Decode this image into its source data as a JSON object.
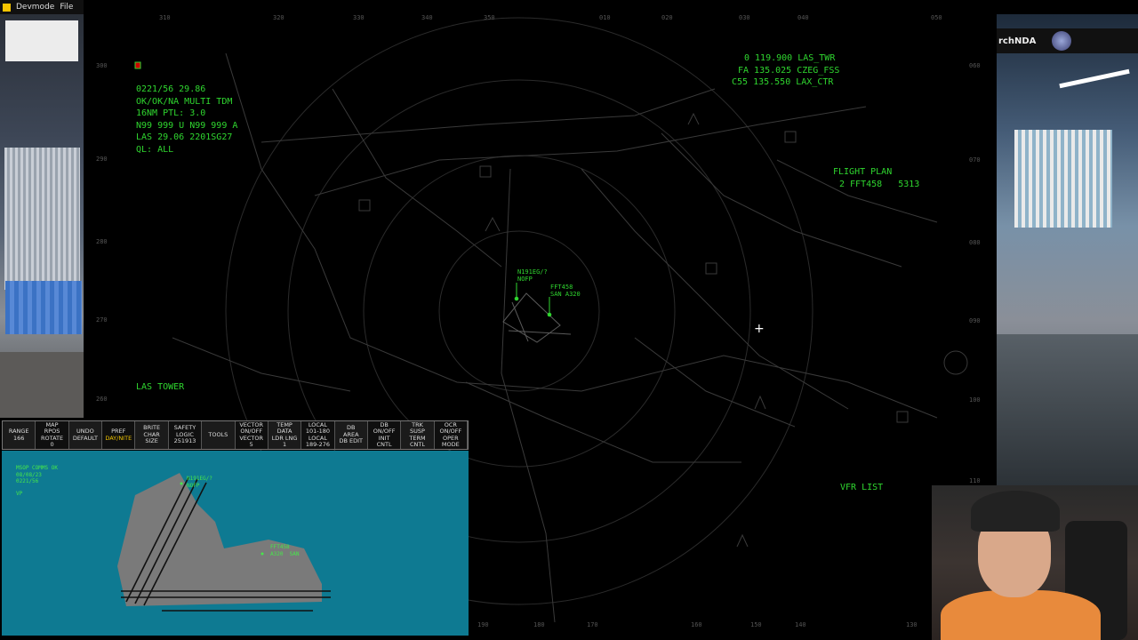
{
  "menubar": {
    "app_label": "Devmode",
    "file_label": "File"
  },
  "user": {
    "name": "rchNDA"
  },
  "radar": {
    "compass_top": [
      "310",
      "320",
      "330",
      "340",
      "350",
      "010",
      "020",
      "030",
      "040",
      "050"
    ],
    "compass_bottom": [
      "190",
      "180",
      "170",
      "160",
      "150",
      "140",
      "130"
    ],
    "compass_left": [
      "300",
      "290",
      "280",
      "270",
      "260"
    ],
    "compass_right": [
      "060",
      "070",
      "080",
      "090",
      "100",
      "110"
    ],
    "status_lines": [
      "0221/56 29.86",
      "OK/OK/NA MULTI TDM",
      "16NM PTL: 3.0",
      "N99 999 U N99 999 A",
      "LAS 29.06 2201SG27",
      "QL: ALL"
    ],
    "frequencies": [
      "0 119.900 LAS_TWR",
      "FA 135.025 CZEG_FSS",
      "C55 135.550 LAX_CTR"
    ],
    "flight_plan_title": "FLIGHT PLAN",
    "flight_plan_entry": "2 FFT458   5313",
    "tower_label": "LAS TOWER",
    "vfr_list_label": "VFR LIST",
    "targets": [
      {
        "callsign": "N191EG/?",
        "info": "NOFP"
      },
      {
        "callsign": "FFT458",
        "info": "SAN A320"
      }
    ]
  },
  "dcb": {
    "buttons": [
      {
        "top": "RANGE",
        "bottom": "166"
      },
      {
        "top": "MAP\nRPOS",
        "bottom": "ROTATE\n0"
      },
      {
        "top": "UNDO",
        "bottom": "DEFAULT"
      },
      {
        "top": "PREF",
        "bottom": "DAY/NITE",
        "highlight": true
      },
      {
        "top": "BRITE",
        "bottom": "CHAR\nSIZE"
      },
      {
        "top": "SAFETY\nLOGIC",
        "bottom": "251913"
      },
      {
        "top": "TOOLS",
        "bottom": ""
      },
      {
        "top": "VECTOR\nON/OFF",
        "bottom": "VECTOR\n5"
      },
      {
        "top": "TEMP\nDATA",
        "bottom": "LDR LNG\n1"
      },
      {
        "top": "LOCAL\n101-180",
        "bottom": "LOCAL\n189-276"
      },
      {
        "top": "DB\nAREA",
        "bottom": "DB EDIT"
      },
      {
        "top": "DB\nON/OFF",
        "bottom": "INIT\nCNTL"
      },
      {
        "top": "TRK\nSUSP",
        "bottom": "TERM\nCNTL"
      },
      {
        "top": "OCR\nON/OFF",
        "bottom": "OPER\nMODE"
      }
    ]
  },
  "minimap": {
    "status": [
      "MSOP COMMS OK",
      "08/08/23",
      "0221/56",
      "VP"
    ],
    "targets": [
      {
        "callsign": "N191EG/?",
        "info": "NOFP"
      },
      {
        "callsign": "FFT458",
        "info": "A320  SAN"
      }
    ]
  },
  "colors": {
    "radar_text": "#2fd62f",
    "minimap_bg": "#0e7a92",
    "highlight": "#f2c600"
  }
}
